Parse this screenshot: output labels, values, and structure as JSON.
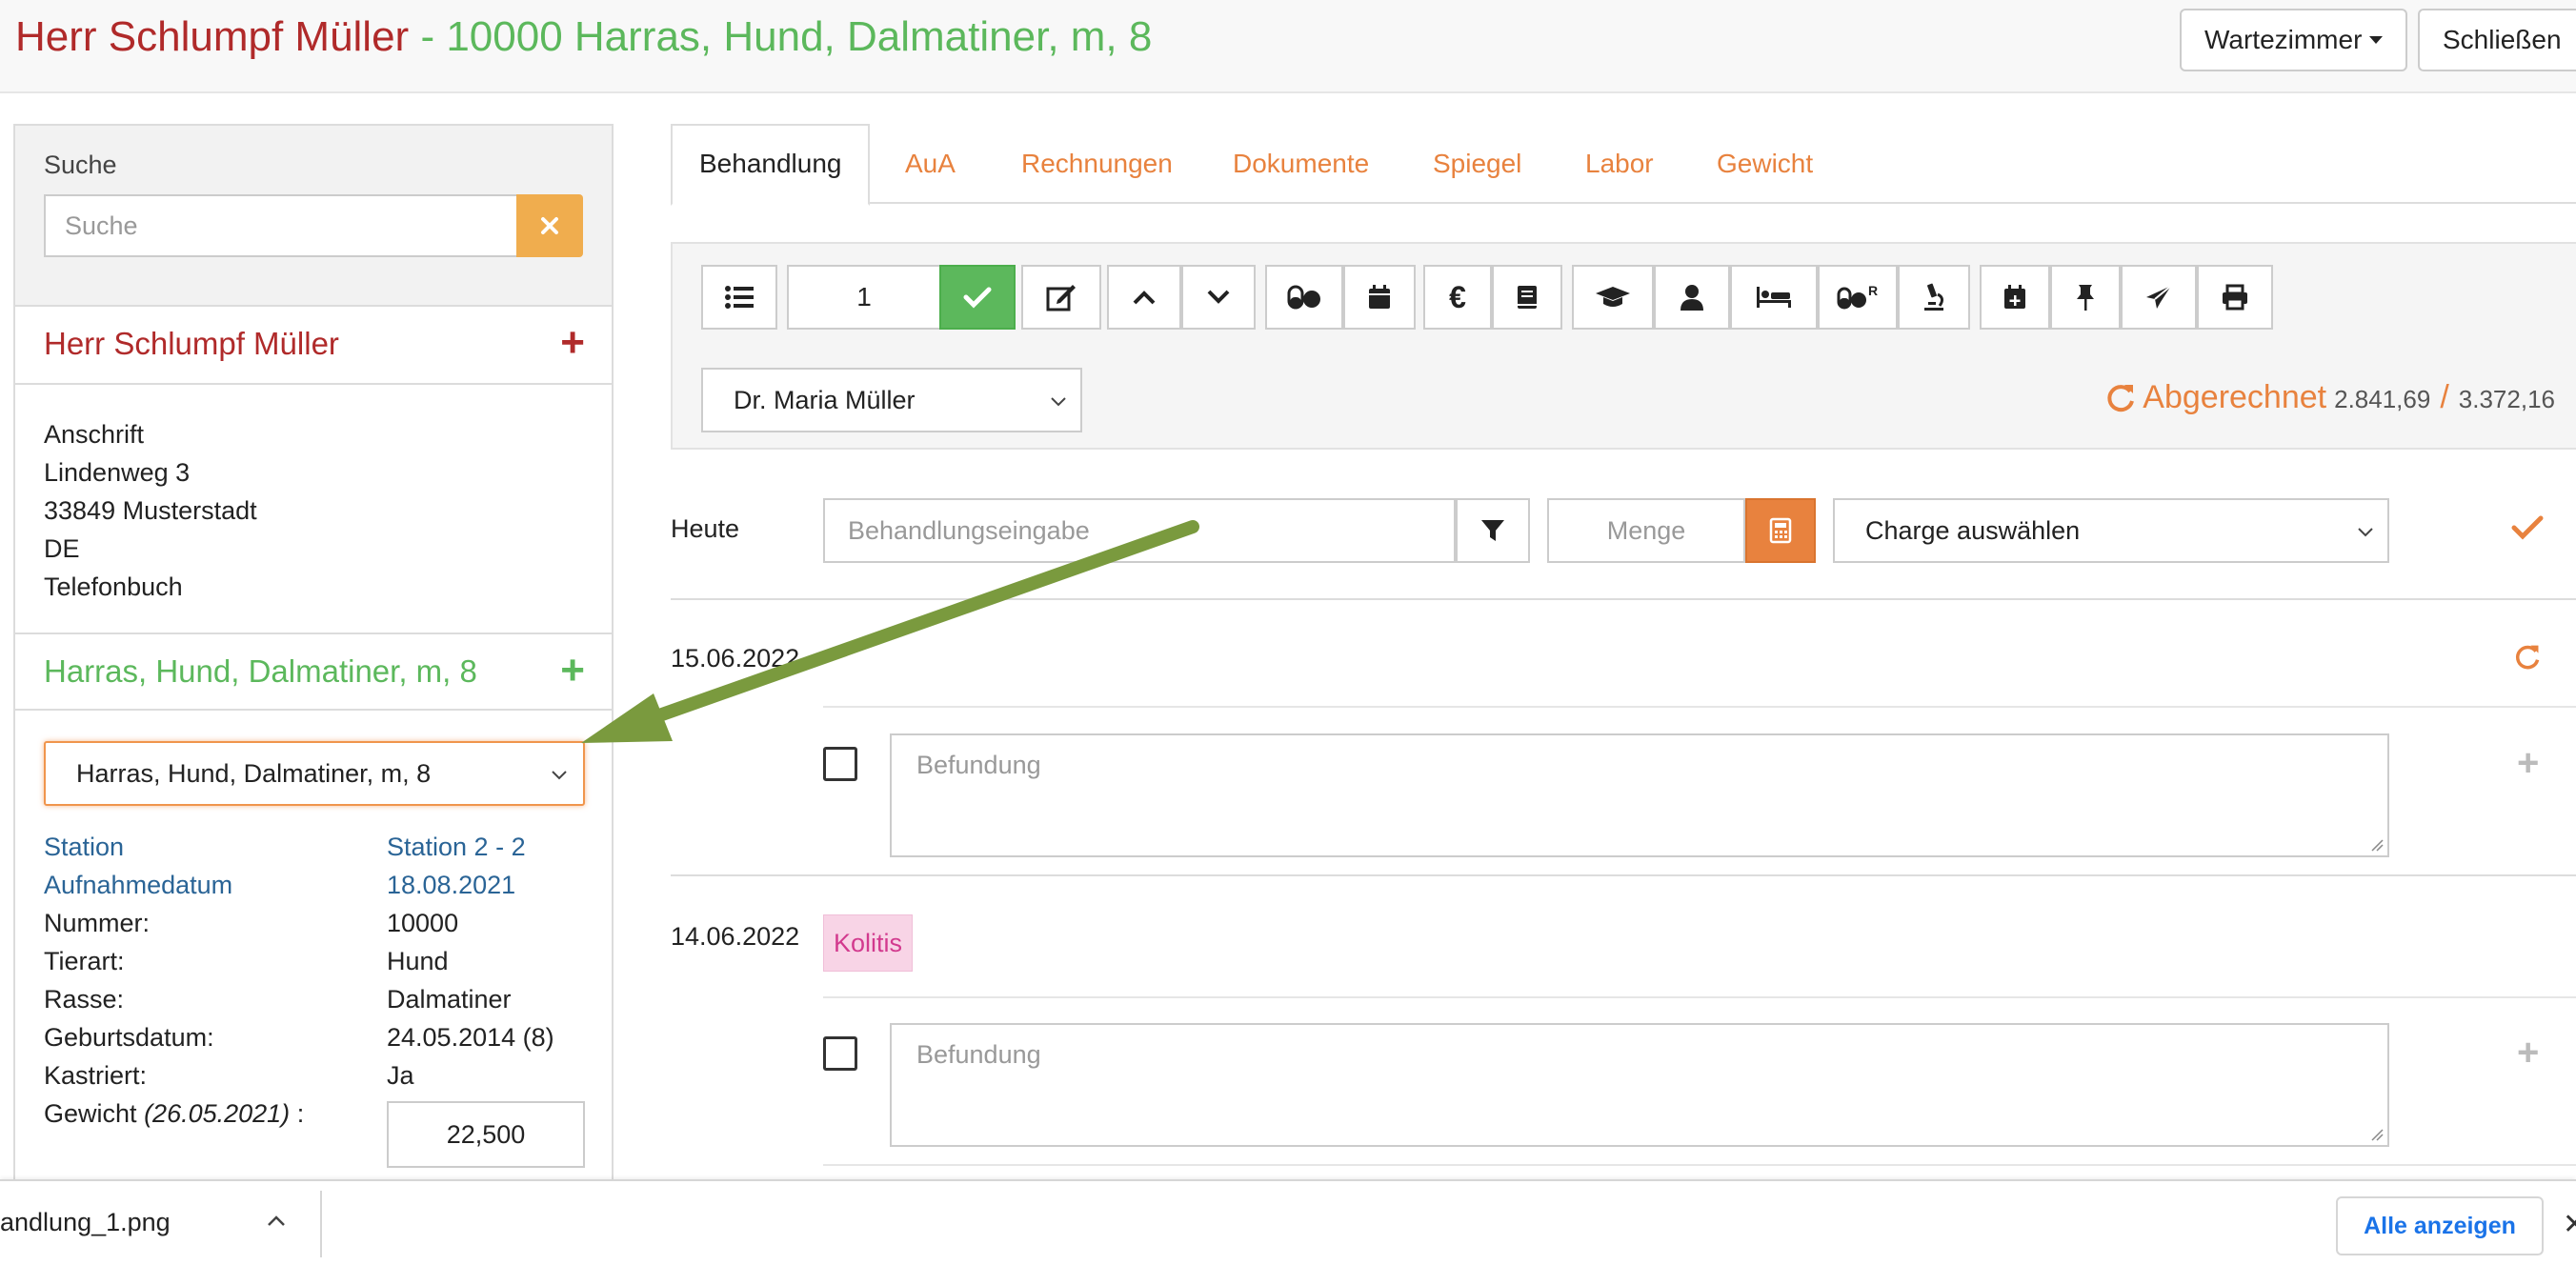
{
  "header": {
    "owner_name": "Herr Schlumpf Müller",
    "patient_info": " - 10000 Harras, Hund, Dalmatiner, m, 8",
    "waiting_room_label": "Wartezimmer",
    "close_label": "Schließen"
  },
  "sidebar": {
    "search_label": "Suche",
    "search_placeholder": "Suche",
    "owner_name": "Herr Schlumpf Müller",
    "address": {
      "heading": "Anschrift",
      "street": "Lindenweg 3",
      "city": "33849  Musterstadt",
      "country": "DE",
      "phonebook": "Telefonbuch"
    },
    "animal_name": "Harras, Hund, Dalmatiner, m, 8",
    "animal_select_value": "Harras, Hund, Dalmatiner, m, 8",
    "details": [
      {
        "label": "Station",
        "value": "Station 2 - 2"
      },
      {
        "label": "Aufnahmedatum",
        "value": "18.08.2021"
      },
      {
        "label": "Nummer:",
        "value": "10000"
      },
      {
        "label": "Tierart:",
        "value": "Hund"
      },
      {
        "label": "Rasse:",
        "value": "Dalmatiner"
      },
      {
        "label": "Geburtsdatum:",
        "value": "24.05.2014  (8)"
      },
      {
        "label": "Kastriert:",
        "value": "Ja"
      }
    ],
    "weight_label": "Gewicht",
    "weight_date": "(26.05.2021)",
    "weight_suffix": " :",
    "weight_value": "22,500"
  },
  "tabs": [
    {
      "label": "Behandlung",
      "active": true
    },
    {
      "label": "AuA"
    },
    {
      "label": "Rechnungen"
    },
    {
      "label": "Dokumente"
    },
    {
      "label": "Spiegel"
    },
    {
      "label": "Labor"
    },
    {
      "label": "Gewicht"
    }
  ],
  "toolbar": {
    "count_value": "1",
    "icons": [
      "list-icon",
      "check-icon",
      "edit-icon",
      "chevron-up-icon",
      "chevron-down-icon",
      "pills-icon",
      "calendar-icon",
      "euro-icon",
      "book-icon",
      "graduation-cap-icon",
      "user-icon",
      "bed-icon",
      "pills-r-icon",
      "microscope-icon",
      "calendar-plus-icon",
      "pin-icon",
      "send-icon",
      "print-icon"
    ],
    "vet_select_value": "Dr. Maria Müller",
    "billing_label": "Abgerechnet",
    "billing_amount": "2.841,69",
    "billing_separator": "/",
    "billing_total": "3.372,16"
  },
  "entry": {
    "day_label": "Heute",
    "treatment_placeholder": "Behandlungseingabe",
    "quantity_placeholder": "Menge",
    "charge_select_value": "Charge auswählen"
  },
  "records": [
    {
      "date": "15.06.2022",
      "findings_placeholder": "Befundung"
    },
    {
      "date": "14.06.2022",
      "tag": "Kolitis",
      "findings_placeholder": "Befundung"
    }
  ],
  "download_bar": {
    "filename": "andlung_1.png",
    "show_all_label": "Alle anzeigen",
    "close_glyph": "✕"
  },
  "colors": {
    "owner_red": "#b02a2a",
    "patient_green": "#5cb85c",
    "accent_orange": "#e8823e",
    "link_blue": "#2a6496",
    "annotation_arrow": "#7a9a3e"
  }
}
